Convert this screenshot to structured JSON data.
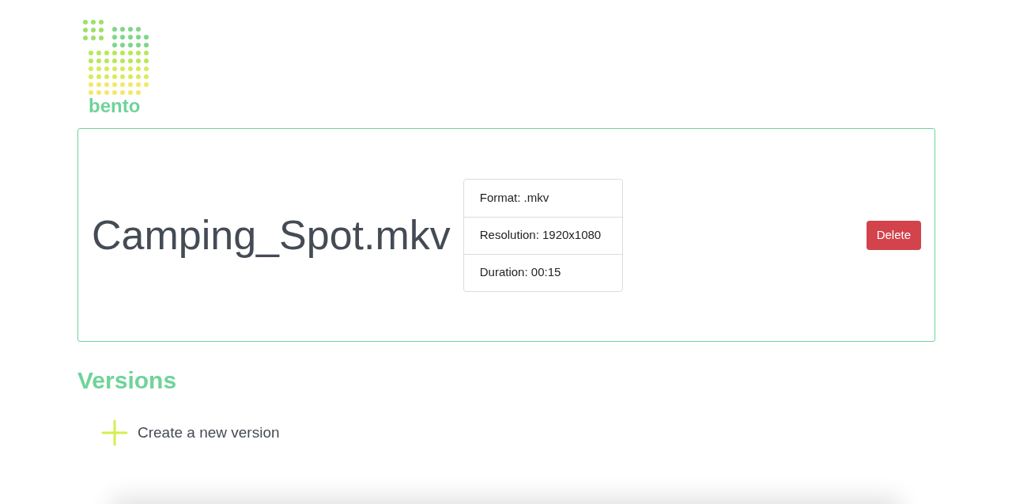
{
  "logo": {
    "text": "bento"
  },
  "video": {
    "title": "Camping_Spot.mkv",
    "details": [
      "Format: .mkv",
      "Resolution: 1920x1080",
      "Duration: 00:15"
    ],
    "delete_label": "Delete"
  },
  "versions": {
    "heading": "Versions",
    "create_label": "Create a new version"
  }
}
